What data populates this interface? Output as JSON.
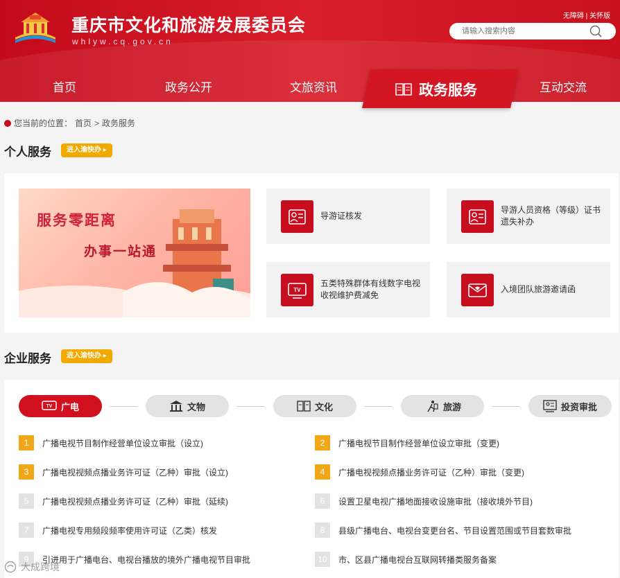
{
  "header": {
    "title": "重庆市文化和旅游发展委员会",
    "url": "whlyw.cq.gov.cn",
    "accessibility_link": "无障碍",
    "separator": "|",
    "care_link": "关怀版",
    "search_placeholder": "请输入搜索内容"
  },
  "nav": {
    "items": [
      "首页",
      "政务公开",
      "文旅资讯",
      "政务服务",
      "互动交流"
    ],
    "active": "政务服务"
  },
  "breadcrumb": {
    "prefix": "您当前的位置：",
    "home": "首页",
    "sep": ">",
    "current": "政务服务"
  },
  "personal": {
    "title": "个人服务",
    "button": "进入渝快办 ▸",
    "banner_line1": "服务零距离",
    "banner_line2": "办事一站通",
    "services": [
      {
        "label": "导游证核发",
        "icon": "id-card-icon"
      },
      {
        "label": "导游人员资格（等级）证书遗失补办",
        "icon": "certificate-icon"
      },
      {
        "label": "五类特殊群体有线数字电视收视维护费减免",
        "icon": "tv-icon"
      },
      {
        "label": "入境团队旅游邀请函",
        "icon": "envelope-icon"
      }
    ]
  },
  "enterprise": {
    "title": "企业服务",
    "button": "进入渝快办 ▸",
    "tabs": [
      {
        "label": "广电",
        "icon": "tv-icon",
        "active": true
      },
      {
        "label": "文物",
        "icon": "museum-icon",
        "active": false
      },
      {
        "label": "文化",
        "icon": "book-icon",
        "active": false
      },
      {
        "label": "旅游",
        "icon": "travel-icon",
        "active": false
      },
      {
        "label": "投资审批",
        "icon": "approval-icon",
        "active": false
      }
    ],
    "items": [
      {
        "num": "1",
        "text": "广播电视节目制作经营单位设立审批（设立)"
      },
      {
        "num": "2",
        "text": "广播电视节目制作经营单位设立审批（变更)"
      },
      {
        "num": "3",
        "text": "广播电视视频点播业务许可证（乙种）审批（设立)"
      },
      {
        "num": "4",
        "text": "广播电视视频点播业务许可证（乙种）审批（变更)"
      },
      {
        "num": "5",
        "text": "广播电视视频点播业务许可证（乙种）审批（延续)"
      },
      {
        "num": "6",
        "text": "设置卫星电视广播地面接收设施审批（接收境外节目)"
      },
      {
        "num": "7",
        "text": "广播电视专用频段频率使用许可证（乙类）核发"
      },
      {
        "num": "8",
        "text": "县级广播电台、电视台变更台名、节目设置范围或节目套数审批"
      },
      {
        "num": "9",
        "text": "引进用于广播电台、电视台播放的境外广播电视节目审批"
      },
      {
        "num": "10",
        "text": "市、区县广播电视台互联网转播类服务备案"
      }
    ]
  },
  "watermark": "大成跨境",
  "colors": {
    "brand_red": "#c70d1e",
    "accent_orange": "#f0a818",
    "inactive_gray": "#e2e2e2"
  }
}
